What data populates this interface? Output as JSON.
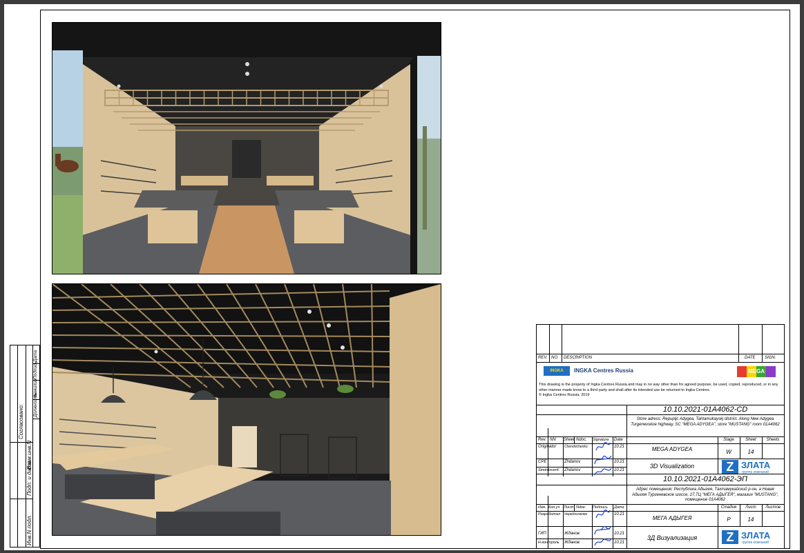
{
  "left_stamp": {
    "labels": [
      "Согласовано:",
      "Инв.N подл.",
      "Подп. и дата",
      "Взам.инв.N"
    ],
    "header_cols": [
      "Должность",
      "Фамилия",
      "Подпись",
      "Дата"
    ]
  },
  "title_block": {
    "rev_header": [
      "REV.",
      "NO.",
      "DESCRIPTION",
      "DATE",
      "SIGN."
    ],
    "ingka_logo_small": "INGKA",
    "ingka_logo_text": "INGKA Centres Russia",
    "mega_logo": "MEGA",
    "notice": "This drawing is the property of Ingka Centres Russia and may in no way other than for agreed  purpose, be used, copied, reproduced,  or in any other manner made know to a third party and shall after its intended use be returned to Ingka Centres.",
    "copyright": "©  Ingka Centres Russia, 2019",
    "doc_code_en": "10.10.2021-01A4062-CD",
    "address_en": "Store adress: Repupljc Adygea, Tahtamukayskj district, Along New Adygea Turgenevskoe highway, SC \"MEGA ADYGEA\", store \"MUSTANG\" room 01A4062",
    "cols_en": [
      "Rev.",
      "NN",
      "Sheet",
      "Ndoc.",
      "Signature",
      "Date"
    ],
    "roles_en": [
      {
        "role": "Originator",
        "name": "Chendrichenko",
        "date": "10.21"
      },
      {
        "role": "CPE",
        "name": "Zhdanov",
        "date": "10.21"
      },
      {
        "role": "Stndrdsverif.",
        "name": "Zhdanov",
        "date": "10.21"
      }
    ],
    "object_en": "MEGA ADYGEA",
    "stage_head_en": [
      "Stage",
      "Sheet",
      "Sheets"
    ],
    "stage_en": "W",
    "sheet_no": "14",
    "title_en": "3D Visualization",
    "zlata_name": "ЗЛАТА",
    "zlata_sub": "группа компаний",
    "zlata_mark": "Z",
    "doc_code_ru": "10.10.2021-01A4062-ЭП",
    "address_ru": "Адрес помещения: Республика Адыгея, Тахтамукайский р-он, а Новая Адыгея Тургеневское шоссе, 27,ТЦ \"МЕГА АДЫГЕЯ\", магазин \"MUSTANG\", помещение 01A4062",
    "cols_ru": [
      "Изм.",
      "Кол.уч",
      "Лист",
      "Ndок.",
      "Подпись",
      "Дата"
    ],
    "roles_ru": [
      {
        "role": "Разработал",
        "name": "Чередниченко",
        "date": "10.21"
      },
      {
        "role": "ГИП",
        "name": "Жданов",
        "date": "10.21"
      },
      {
        "role": "Н.контроль",
        "name": "Жданов",
        "date": "10.21"
      }
    ],
    "object_ru": "МЕГА АДЫГЕЯ",
    "stage_head_ru": [
      "Стадия",
      "Лист",
      "Листов"
    ],
    "stage_ru": "Р",
    "title_ru": "3Д Визуализация"
  },
  "colors": {
    "wood": "#d8bf94",
    "ceiling": "#1a1a1a",
    "floor_grey": "#5d5f63",
    "floor_wood": "#c99663",
    "accent_blue": "#1f6fc2",
    "signature_blue": "#2a4fd1"
  }
}
